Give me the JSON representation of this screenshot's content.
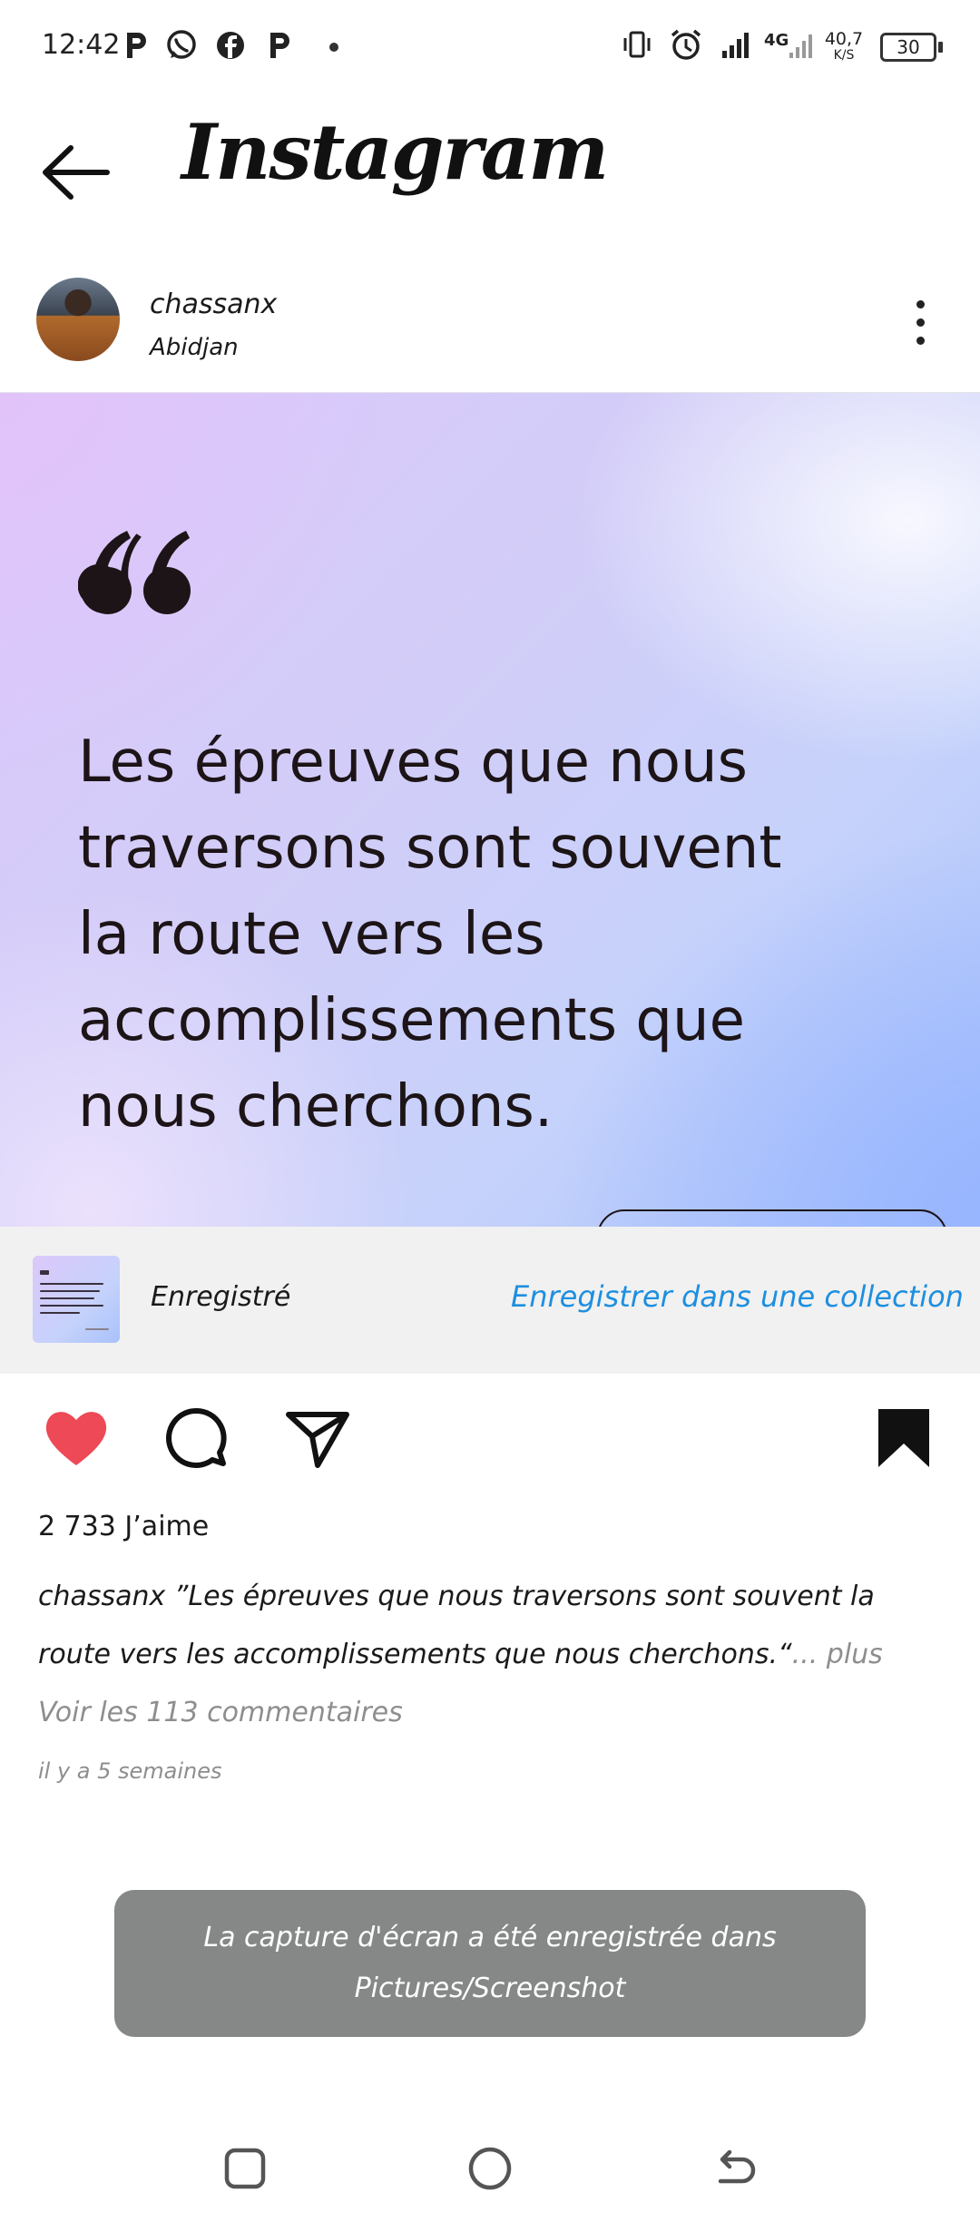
{
  "status_bar": {
    "time": "12:42",
    "net_speed_value": "40,7",
    "net_speed_unit": "K/S",
    "network_type": "4G",
    "battery": "30",
    "notification_icons": [
      "pinterest-icon",
      "whatsapp-icon",
      "facebook-icon",
      "pinterest-icon",
      "dot-icon"
    ],
    "system_icons": [
      "vibrate-icon",
      "alarm-icon",
      "signal-icon",
      "signal-4g-icon",
      "battery-icon"
    ]
  },
  "header": {
    "title": "Instagram",
    "back_icon": "back-arrow-icon"
  },
  "post": {
    "username": "chassanx",
    "location": "Abidjan",
    "more_icon": "more-vertical-icon",
    "image": {
      "quote_lines": [
        "Les épreuves que nous",
        "traversons sont souvent",
        "la route vers les",
        "accomplissements que",
        "nous cherchons."
      ]
    },
    "saved_banner": {
      "label": "Enregistré",
      "action": "Enregistrer dans une collection"
    },
    "actions": {
      "liked": true,
      "saved": true,
      "like_color": "#ed4956",
      "icons": [
        "heart-icon",
        "comment-icon",
        "share-icon",
        "bookmark-icon"
      ]
    },
    "likes": "2 733 J’aime",
    "caption_user": "chassanx",
    "caption_text": " ”Les épreuves que nous traversons sont souvent la route vers les accomplissements que nous cherchons.“",
    "caption_more": "... plus",
    "view_comments": "Voir les 113 commentaires",
    "time_ago": "il y a 5 semaines"
  },
  "toast": {
    "line1": "La capture d'écran a été enregistrée dans",
    "line2": "Pictures/Screenshot"
  },
  "nav_bar": {
    "icons": [
      "recents-icon",
      "home-icon",
      "back-icon"
    ]
  },
  "colors": {
    "link_blue": "#1d8fe0",
    "toast_bg": "#868787",
    "banner_bg": "#f1f1f1"
  }
}
